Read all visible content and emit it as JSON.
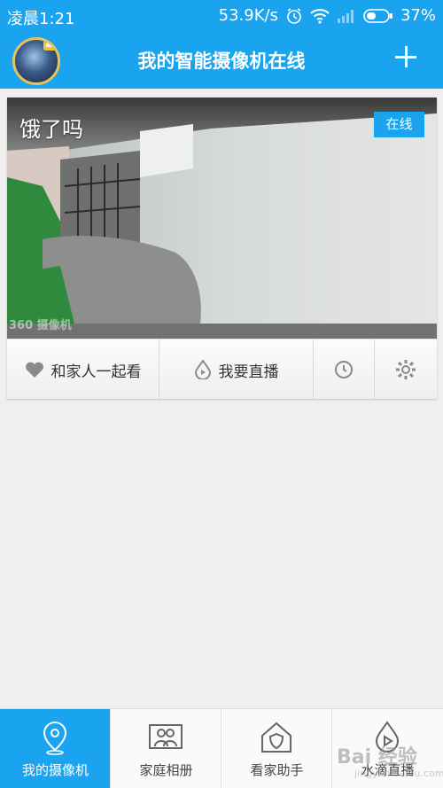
{
  "status_bar": {
    "time": "凌晨1:21",
    "network_speed": "53.9K/s",
    "battery_percent": "37%"
  },
  "app_bar": {
    "title": "我的智能摄像机在线",
    "avatar_icon": "user-avatar",
    "add_icon": "plus-icon"
  },
  "camera_card": {
    "name": "饿了吗",
    "status_badge": "在线",
    "watermark": "360 摄像机",
    "actions": [
      {
        "label": "和家人一起看",
        "icon": "heart-icon"
      },
      {
        "label": "我要直播",
        "icon": "live-drop-icon"
      },
      {
        "label": "",
        "icon": "clock-icon"
      },
      {
        "label": "",
        "icon": "gear-icon"
      }
    ]
  },
  "tab_bar": {
    "tabs": [
      {
        "label": "我的摄像机",
        "icon": "location-pin-icon",
        "active": true
      },
      {
        "label": "家庭相册",
        "icon": "photo-album-icon",
        "active": false
      },
      {
        "label": "看家助手",
        "icon": "home-shield-icon",
        "active": false
      },
      {
        "label": "水滴直播",
        "icon": "play-drop-icon",
        "active": false
      }
    ]
  },
  "watermark": {
    "text": "Bai 经验",
    "sub": "jingyan.baidu.com"
  },
  "colors": {
    "primary": "#1aa3ef",
    "background": "#efefef"
  }
}
